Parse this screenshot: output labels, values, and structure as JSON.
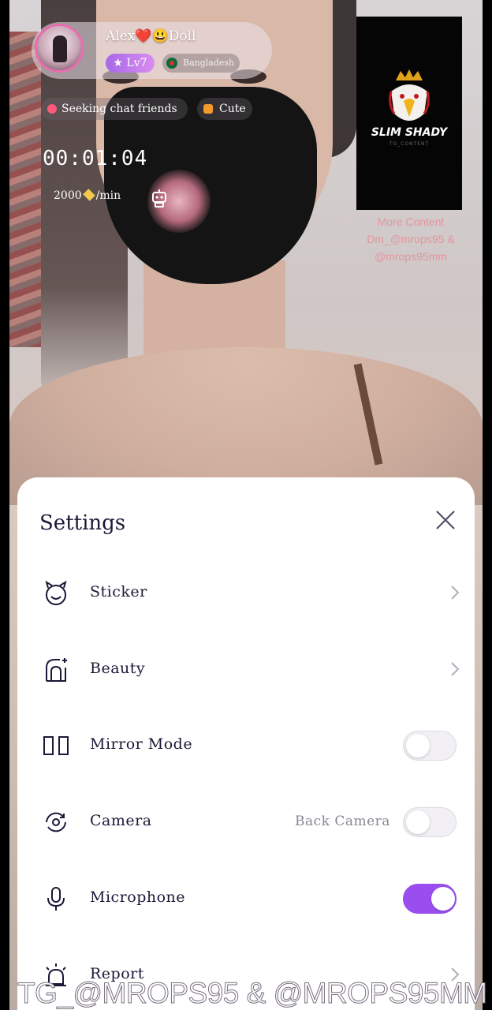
{
  "overlay": {
    "username": "Alex❤️😃Doll",
    "level": "Lv7",
    "country": "Bangladesh",
    "tags": [
      "Seeking chat friends",
      "Cute"
    ],
    "timer": "00:01:04",
    "rate_amount": "2000",
    "rate_unit": "/min"
  },
  "branding": {
    "logo_title": "SLIM SHADY",
    "logo_subtitle": "TG_CONTENT",
    "promo_lines": [
      "More Content",
      "Dm_@mrops95 &",
      "@mrops95mm"
    ]
  },
  "settings": {
    "title": "Settings",
    "items": [
      {
        "label": "Sticker",
        "icon": "sticker-icon",
        "control": "chevron"
      },
      {
        "label": "Beauty",
        "icon": "beauty-icon",
        "control": "chevron"
      },
      {
        "label": "Mirror Mode",
        "icon": "mirror-icon",
        "control": "toggle",
        "on": false
      },
      {
        "label": "Camera",
        "icon": "camera-switch-icon",
        "control": "toggle",
        "on": false,
        "value": "Back Camera"
      },
      {
        "label": "Microphone",
        "icon": "microphone-icon",
        "control": "toggle",
        "on": true
      },
      {
        "label": "Report",
        "icon": "alarm-icon",
        "control": "chevron"
      }
    ]
  },
  "watermark": "TG_@MROPS95 & @MROPS95MM",
  "colors": {
    "accent": "#9a4ef0",
    "title_text": "#1d1838",
    "sheet_bg": "#ffffff"
  }
}
